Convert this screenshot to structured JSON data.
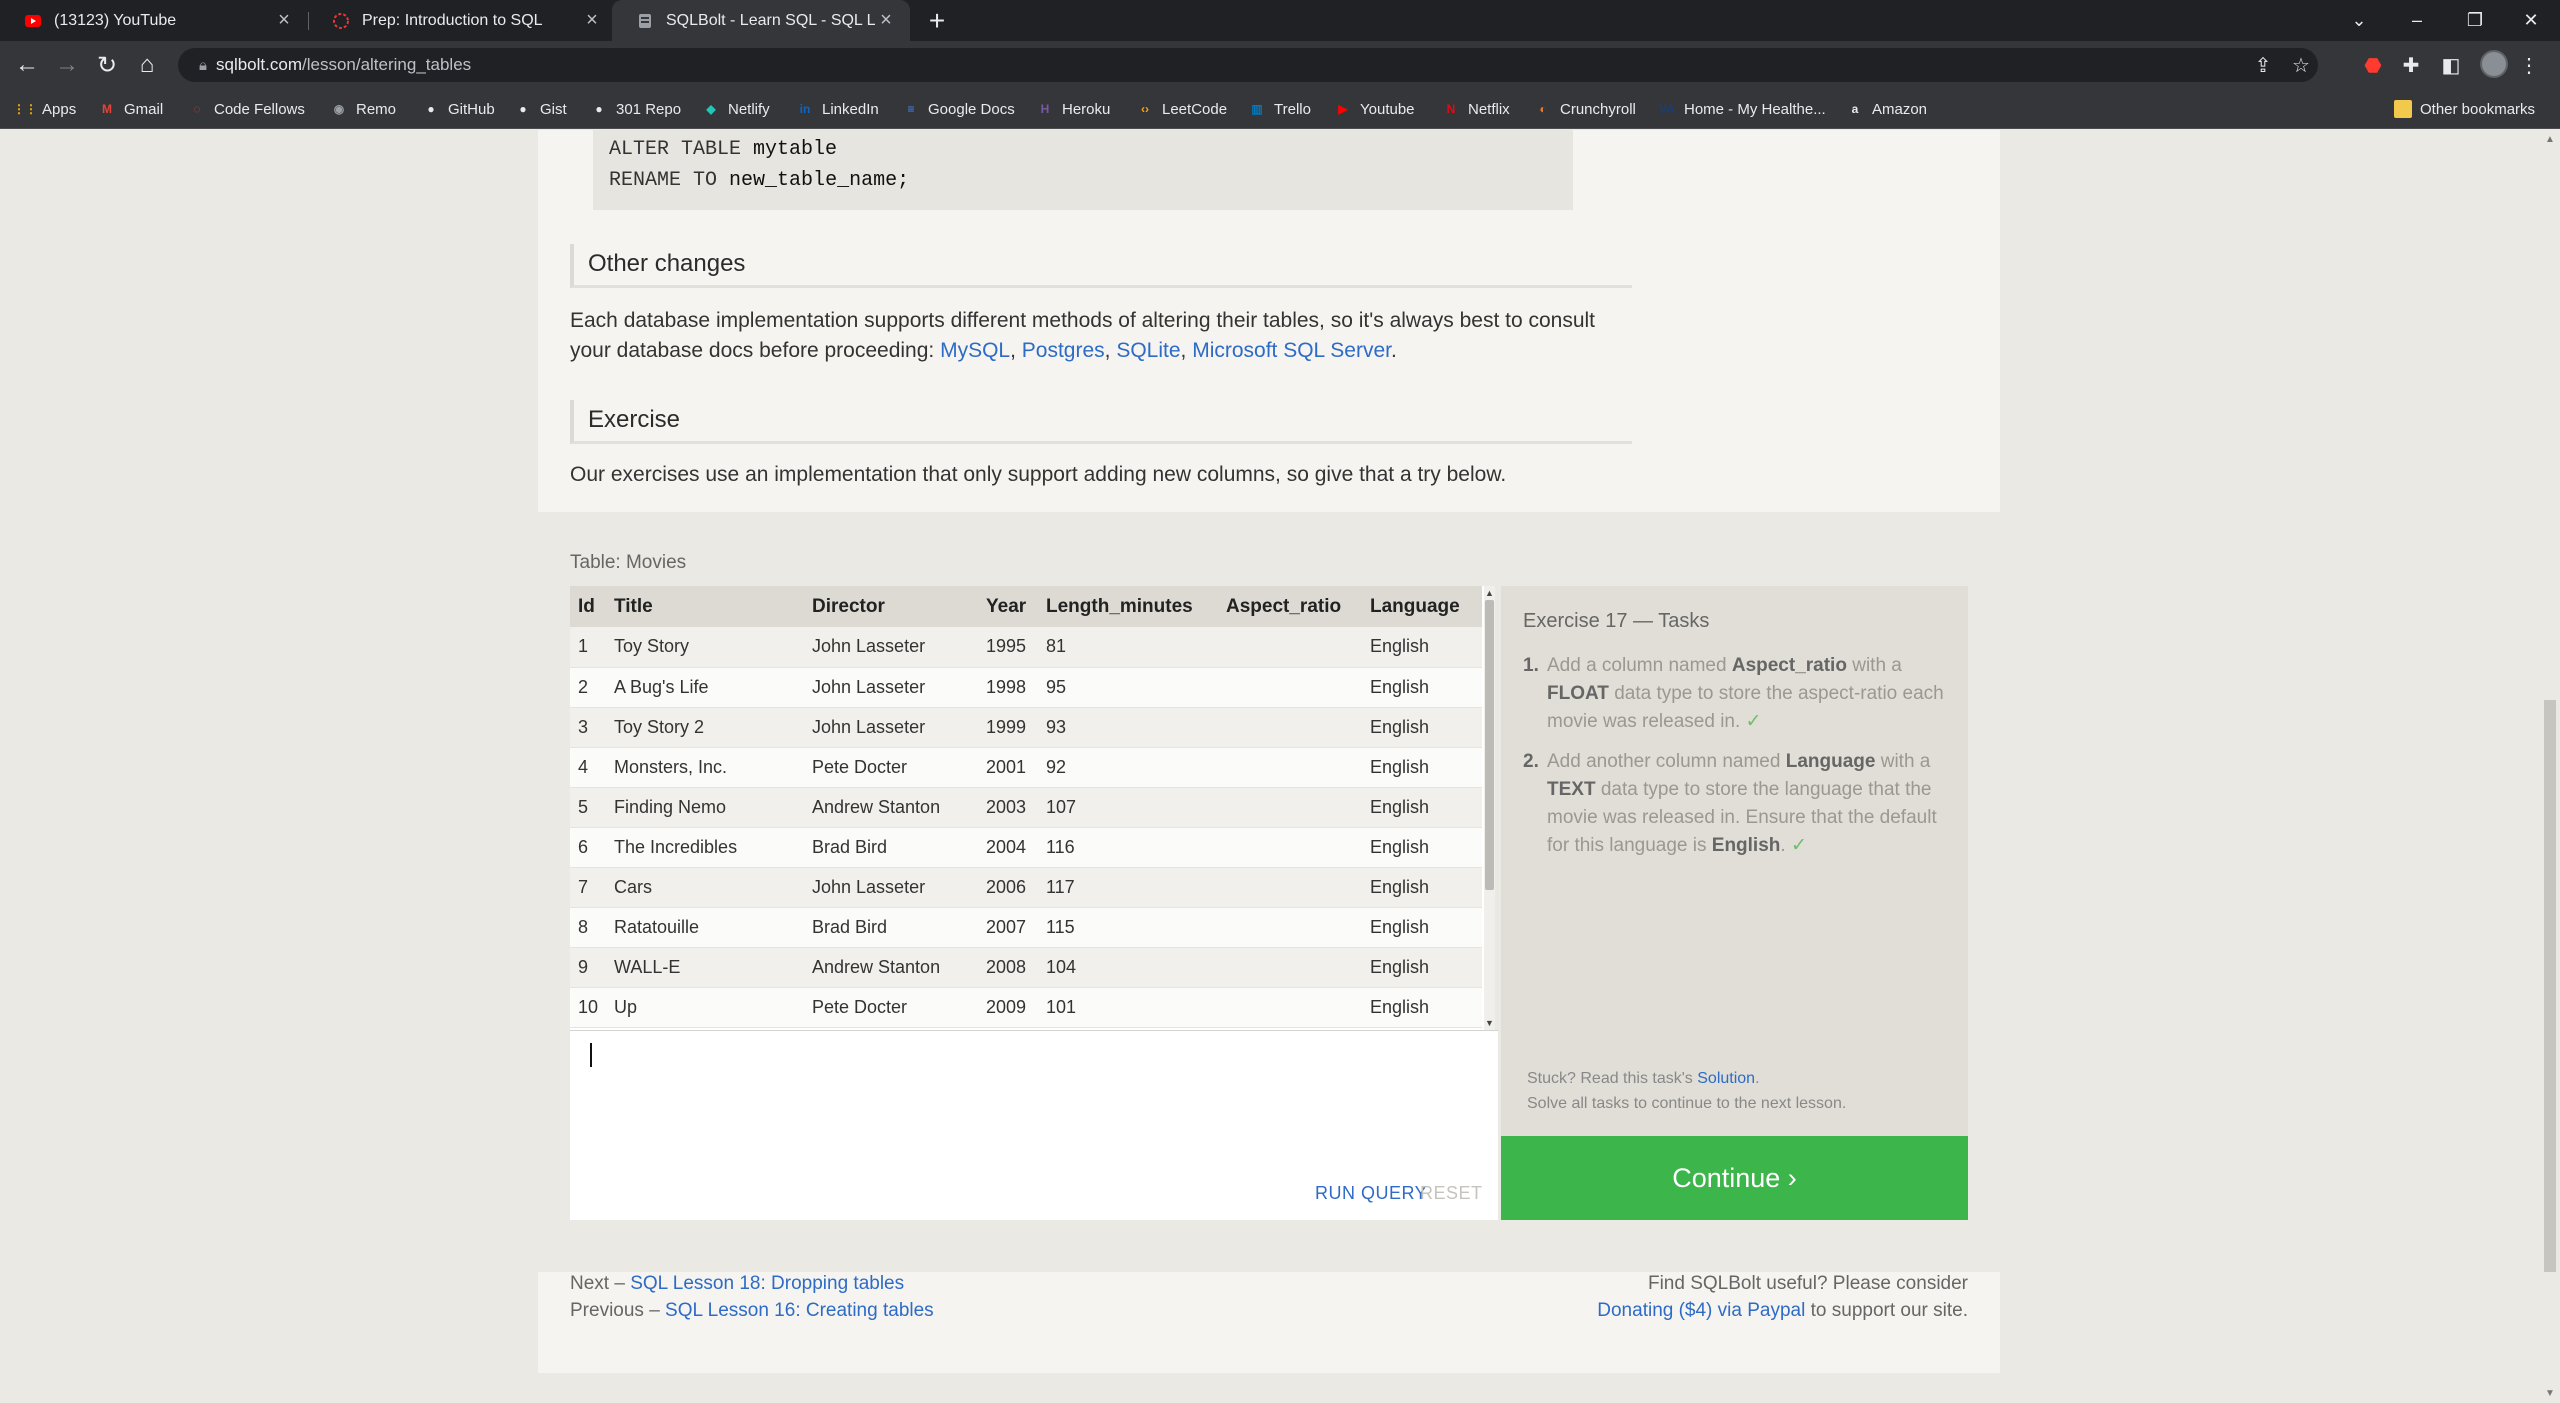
{
  "browser": {
    "tabs": [
      {
        "title": "(13123) YouTube",
        "icon": "youtube-icon"
      },
      {
        "title": "Prep: Introduction to SQL",
        "icon": "codefellows-icon"
      },
      {
        "title": "SQLBolt - Learn SQL - SQL Lesson",
        "icon": "sqlbolt-icon"
      }
    ],
    "url_host": "sqlbolt.com",
    "url_path": "/lesson/altering_tables",
    "bookmarks": [
      {
        "label": "Apps",
        "icon": "apps-grid-icon",
        "color": "#f4b400"
      },
      {
        "label": "Gmail",
        "icon": "gmail-icon",
        "color": "#ea4335"
      },
      {
        "label": "Code Fellows",
        "icon": "codefellows-icon",
        "color": "#e53935"
      },
      {
        "label": "Remo",
        "icon": "remo-icon",
        "color": "#9aa0a6"
      },
      {
        "label": "GitHub",
        "icon": "github-icon",
        "color": "#e8eaed"
      },
      {
        "label": "Gist",
        "icon": "github-icon",
        "color": "#e8eaed"
      },
      {
        "label": "301 Repo",
        "icon": "github-icon",
        "color": "#e8eaed"
      },
      {
        "label": "Netlify",
        "icon": "netlify-icon",
        "color": "#20c6b7"
      },
      {
        "label": "LinkedIn",
        "icon": "linkedin-icon",
        "color": "#0a66c2"
      },
      {
        "label": "Google Docs",
        "icon": "google-docs-icon",
        "color": "#4285f4"
      },
      {
        "label": "Heroku",
        "icon": "heroku-icon",
        "color": "#79589f"
      },
      {
        "label": "LeetCode",
        "icon": "leetcode-icon",
        "color": "#ffa116"
      },
      {
        "label": "Trello",
        "icon": "trello-icon",
        "color": "#0079bf"
      },
      {
        "label": "Youtube",
        "icon": "youtube-icon",
        "color": "#ff0000"
      },
      {
        "label": "Netflix",
        "icon": "netflix-icon",
        "color": "#e50914"
      },
      {
        "label": "Crunchyroll",
        "icon": "crunchyroll-icon",
        "color": "#f47521"
      },
      {
        "label": "Home - My Healthe...",
        "icon": "va-icon",
        "color": "#1a3e72"
      },
      {
        "label": "Amazon",
        "icon": "amazon-icon",
        "color": "#e8eaed"
      }
    ],
    "other_bookmarks": "Other bookmarks"
  },
  "lesson": {
    "code_lines": [
      {
        "kw": "ALTER TABLE",
        "name": "mytable"
      },
      {
        "kw": "RENAME TO",
        "name": "new_table_name;"
      }
    ],
    "other_changes_heading": "Other changes",
    "other_changes_text": "Each database implementation supports different methods of altering their tables, so it's always best to consult your database docs before proceeding: ",
    "db_links": [
      "MySQL",
      "Postgres",
      "SQLite",
      "Microsoft SQL Server"
    ],
    "exercise_heading": "Exercise",
    "exercise_text": "Our exercises use an implementation that only support adding new columns, so give that a try below."
  },
  "exercise": {
    "table_caption": "Table: Movies",
    "columns": [
      "Id",
      "Title",
      "Director",
      "Year",
      "Length_minutes",
      "Aspect_ratio",
      "Language"
    ],
    "rows": [
      [
        "1",
        "Toy Story",
        "John Lasseter",
        "1995",
        "81",
        "",
        "English"
      ],
      [
        "2",
        "A Bug's Life",
        "John Lasseter",
        "1998",
        "95",
        "",
        "English"
      ],
      [
        "3",
        "Toy Story 2",
        "John Lasseter",
        "1999",
        "93",
        "",
        "English"
      ],
      [
        "4",
        "Monsters, Inc.",
        "Pete Docter",
        "2001",
        "92",
        "",
        "English"
      ],
      [
        "5",
        "Finding Nemo",
        "Andrew Stanton",
        "2003",
        "107",
        "",
        "English"
      ],
      [
        "6",
        "The Incredibles",
        "Brad Bird",
        "2004",
        "116",
        "",
        "English"
      ],
      [
        "7",
        "Cars",
        "John Lasseter",
        "2006",
        "117",
        "",
        "English"
      ],
      [
        "8",
        "Ratatouille",
        "Brad Bird",
        "2007",
        "115",
        "",
        "English"
      ],
      [
        "9",
        "WALL-E",
        "Andrew Stanton",
        "2008",
        "104",
        "",
        "English"
      ],
      [
        "10",
        "Up",
        "Pete Docter",
        "2009",
        "101",
        "",
        "English"
      ]
    ],
    "run_query": "RUN QUERY",
    "reset": "RESET",
    "tasks_title": "Exercise 17 — Tasks",
    "tasks": [
      {
        "num": "1.",
        "a": "Add a column named ",
        "b1": "Aspect_ratio",
        "c": " with a ",
        "b2": "FLOAT",
        "d": " data type to store the aspect-ratio each movie was released in.",
        "check": "✓"
      },
      {
        "num": "2.",
        "a": "Add another column named ",
        "b1": "Language",
        "c": " with a ",
        "b2": "TEXT",
        "d": " data type to store the language that the movie was released in. Ensure that the default for this language is ",
        "b3": "English",
        "e": ".",
        "check": "✓"
      }
    ],
    "stuck_prefix": "Stuck? Read this task's ",
    "solution_link": "Solution",
    "stuck_suffix": ".",
    "solve_all": "Solve all tasks to continue to the next lesson.",
    "continue": "Continue ›"
  },
  "pager": {
    "next_prefix": "Next – ",
    "next_link": "SQL Lesson 18: Dropping tables",
    "prev_prefix": "Previous – ",
    "prev_link": "SQL Lesson 16: Creating tables",
    "support_line1": "Find SQLBolt useful? Please consider",
    "donate_link": "Donating ($4) via Paypal",
    "support_suffix": " to support our site."
  },
  "colors": {
    "link": "#2e6bc6",
    "continue_green": "#3cb54a",
    "check_green": "#6dbf6d"
  }
}
